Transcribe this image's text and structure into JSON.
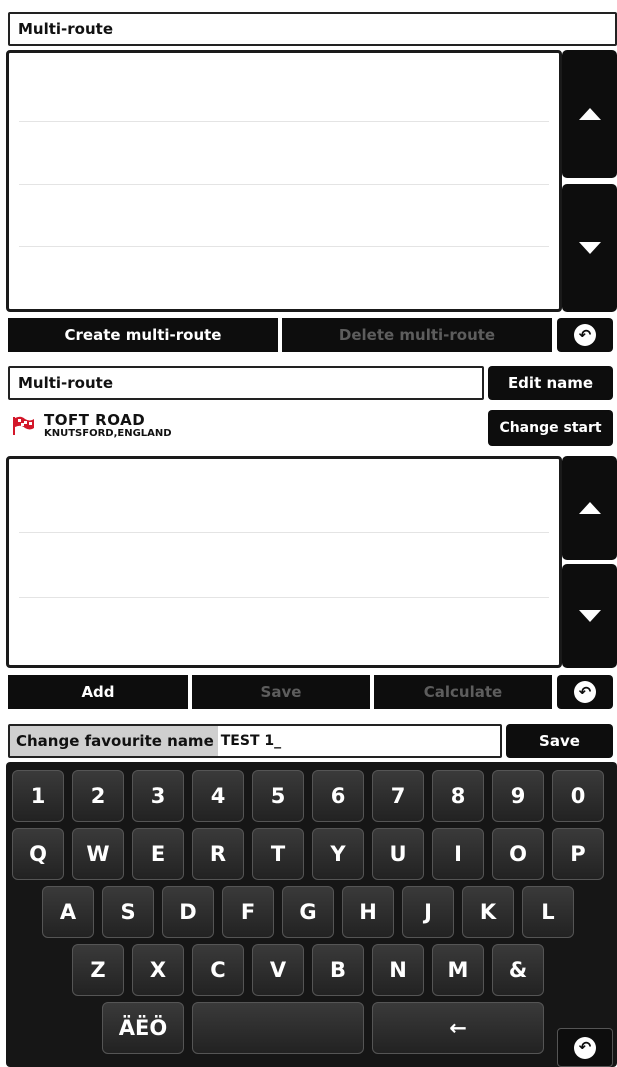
{
  "panel1": {
    "title": "Multi-route",
    "buttons": {
      "create": "Create multi-route",
      "delete": "Delete multi-route"
    }
  },
  "panel2": {
    "title": "Multi-route",
    "edit_name": "Edit name",
    "change_start": "Change start",
    "start_location": {
      "street": "TOFT ROAD",
      "town": "KNUTSFORD,ENGLAND"
    },
    "buttons": {
      "add": "Add",
      "save": "Save",
      "calculate": "Calculate"
    }
  },
  "panel3": {
    "field_label": "Change favourite name",
    "field_value": "TEST 1_",
    "save": "Save",
    "keyboard": {
      "row1": [
        "1",
        "2",
        "3",
        "4",
        "5",
        "6",
        "7",
        "8",
        "9",
        "0"
      ],
      "row2": [
        "Q",
        "W",
        "E",
        "R",
        "T",
        "Y",
        "U",
        "I",
        "O",
        "P"
      ],
      "row3": [
        "A",
        "S",
        "D",
        "F",
        "G",
        "H",
        "J",
        "K",
        "L"
      ],
      "row4": [
        "Z",
        "X",
        "C",
        "V",
        "B",
        "N",
        "M",
        "&"
      ],
      "special": "ÄËÖ",
      "backspace": "←"
    }
  },
  "icons": {
    "scroll_up": "arrow-up-icon",
    "scroll_down": "arrow-down-icon",
    "back": "back-arrow-icon",
    "start_flag": "checkered-flag-icon"
  },
  "colors": {
    "dark": "#0d0d0d",
    "disabled_text": "#5d5d5d",
    "flag_red": "#d3172a"
  }
}
